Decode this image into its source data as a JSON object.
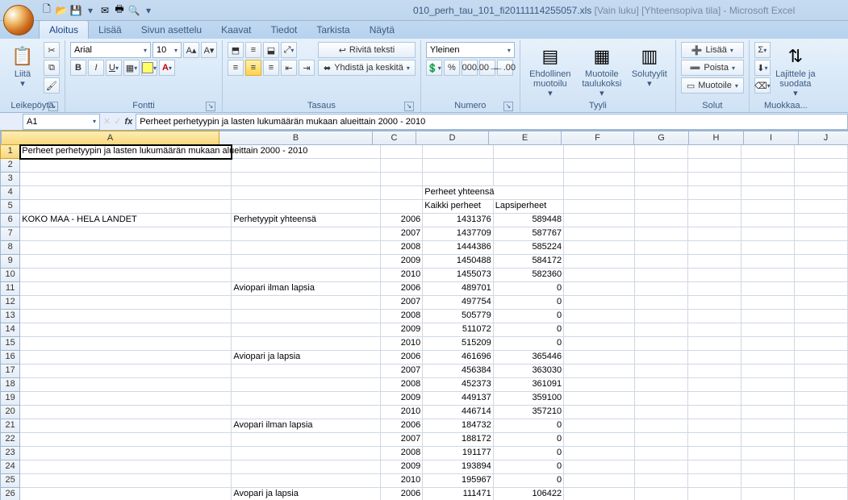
{
  "title": {
    "filename": "010_perh_tau_101_fi20111114255057.xls",
    "tags": "[Vain luku]  [Yhteensopiva tila]",
    "app": "Microsoft Excel"
  },
  "tabs": {
    "t0": "Aloitus",
    "t1": "Lisää",
    "t2": "Sivun asettelu",
    "t3": "Kaavat",
    "t4": "Tiedot",
    "t5": "Tarkista",
    "t6": "Näytä"
  },
  "ribbon": {
    "clipboard": {
      "paste": "Liitä",
      "label": "Leikepöytä"
    },
    "font": {
      "name": "Arial",
      "size": "10",
      "label": "Fontti"
    },
    "align": {
      "wrap": "Rivitä teksti",
      "merge": "Yhdistä ja keskitä",
      "label": "Tasaus"
    },
    "number": {
      "format": "Yleinen",
      "label": "Numero"
    },
    "styles": {
      "cond": "Ehdollinen muotoilu",
      "table": "Muotoile taulukoksi",
      "cell": "Solutyylit",
      "label": "Tyyli"
    },
    "cells": {
      "ins": "Lisää",
      "del": "Poista",
      "fmt": "Muotoile",
      "label": "Solut"
    },
    "editing": {
      "sort": "Lajittele ja suodata",
      "label": "Muokkaa..."
    }
  },
  "namebox": "A1",
  "formula": "Perheet perhetyypin ja lasten lukumäärän mukaan alueittain 2000 - 2010",
  "cols": [
    "A",
    "B",
    "C",
    "D",
    "E",
    "F",
    "G",
    "H",
    "I",
    "J"
  ],
  "rows": [
    {
      "n": 1,
      "A": "Perheet perhetyypin ja lasten lukumäärän mukaan alueittain 2000 - 2010"
    },
    {
      "n": 2
    },
    {
      "n": 3
    },
    {
      "n": 4,
      "D": "Perheet yhteensä"
    },
    {
      "n": 5,
      "D": "Kaikki perheet",
      "E": "Lapsiperheet"
    },
    {
      "n": 6,
      "A": "KOKO MAA - HELA LANDET",
      "B": "Perhetyypit yhteensä",
      "C": "2006",
      "D": "1431376",
      "E": "589448"
    },
    {
      "n": 7,
      "C": "2007",
      "D": "1437709",
      "E": "587767"
    },
    {
      "n": 8,
      "C": "2008",
      "D": "1444386",
      "E": "585224"
    },
    {
      "n": 9,
      "C": "2009",
      "D": "1450488",
      "E": "584172"
    },
    {
      "n": 10,
      "C": "2010",
      "D": "1455073",
      "E": "582360"
    },
    {
      "n": 11,
      "B": "Aviopari ilman lapsia",
      "C": "2006",
      "D": "489701",
      "E": "0"
    },
    {
      "n": 12,
      "C": "2007",
      "D": "497754",
      "E": "0"
    },
    {
      "n": 13,
      "C": "2008",
      "D": "505779",
      "E": "0"
    },
    {
      "n": 14,
      "C": "2009",
      "D": "511072",
      "E": "0"
    },
    {
      "n": 15,
      "C": "2010",
      "D": "515209",
      "E": "0"
    },
    {
      "n": 16,
      "B": "Aviopari ja lapsia",
      "C": "2006",
      "D": "461696",
      "E": "365446"
    },
    {
      "n": 17,
      "C": "2007",
      "D": "456384",
      "E": "363030"
    },
    {
      "n": 18,
      "C": "2008",
      "D": "452373",
      "E": "361091"
    },
    {
      "n": 19,
      "C": "2009",
      "D": "449137",
      "E": "359100"
    },
    {
      "n": 20,
      "C": "2010",
      "D": "446714",
      "E": "357210"
    },
    {
      "n": 21,
      "B": "Avopari ilman lapsia",
      "C": "2006",
      "D": "184732",
      "E": "0"
    },
    {
      "n": 22,
      "C": "2007",
      "D": "188172",
      "E": "0"
    },
    {
      "n": 23,
      "C": "2008",
      "D": "191177",
      "E": "0"
    },
    {
      "n": 24,
      "C": "2009",
      "D": "193894",
      "E": "0"
    },
    {
      "n": 25,
      "C": "2010",
      "D": "195967",
      "E": "0"
    },
    {
      "n": 26,
      "B": "Avopari ja lapsia",
      "C": "2006",
      "D": "111471",
      "E": "106422"
    }
  ]
}
